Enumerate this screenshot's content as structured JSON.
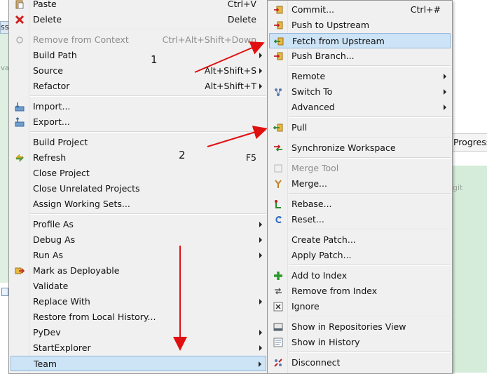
{
  "background": {
    "tab_fragment": "ss",
    "left_fragment": "va",
    "progress_tab": "Progress",
    "git_fragment": "git"
  },
  "main_menu": {
    "items": [
      {
        "label": "Paste",
        "shortcut": "Ctrl+V"
      },
      {
        "label": "Delete",
        "shortcut": "Delete"
      },
      {
        "label": "Remove from Context",
        "shortcut": "Ctrl+Alt+Shift+Down"
      },
      {
        "label": "Build Path"
      },
      {
        "label": "Source",
        "shortcut": "Alt+Shift+S"
      },
      {
        "label": "Refactor",
        "shortcut": "Alt+Shift+T"
      },
      {
        "label": "Import..."
      },
      {
        "label": "Export..."
      },
      {
        "label": "Build Project"
      },
      {
        "label": "Refresh",
        "shortcut": "F5"
      },
      {
        "label": "Close Project"
      },
      {
        "label": "Close Unrelated Projects"
      },
      {
        "label": "Assign Working Sets..."
      },
      {
        "label": "Profile As"
      },
      {
        "label": "Debug As"
      },
      {
        "label": "Run As"
      },
      {
        "label": "Mark as Deployable"
      },
      {
        "label": "Validate"
      },
      {
        "label": "Replace With"
      },
      {
        "label": "Restore from Local History..."
      },
      {
        "label": "PyDev"
      },
      {
        "label": "StartExplorer"
      },
      {
        "label": "Team"
      }
    ]
  },
  "team_menu": {
    "items": [
      {
        "label": "Commit...",
        "shortcut": "Ctrl+#"
      },
      {
        "label": "Push to Upstream"
      },
      {
        "label": "Fetch from Upstream"
      },
      {
        "label": "Push Branch..."
      },
      {
        "label": "Remote"
      },
      {
        "label": "Switch To"
      },
      {
        "label": "Advanced"
      },
      {
        "label": "Pull"
      },
      {
        "label": "Synchronize Workspace"
      },
      {
        "label": "Merge Tool"
      },
      {
        "label": "Merge..."
      },
      {
        "label": "Rebase..."
      },
      {
        "label": "Reset..."
      },
      {
        "label": "Create Patch..."
      },
      {
        "label": "Apply Patch..."
      },
      {
        "label": "Add to Index"
      },
      {
        "label": "Remove from Index"
      },
      {
        "label": "Ignore"
      },
      {
        "label": "Show in Repositories View"
      },
      {
        "label": "Show in History"
      },
      {
        "label": "Disconnect"
      }
    ]
  },
  "annotations": {
    "note_1": "1",
    "note_2": "2",
    "arrow_color": "#e01010"
  }
}
